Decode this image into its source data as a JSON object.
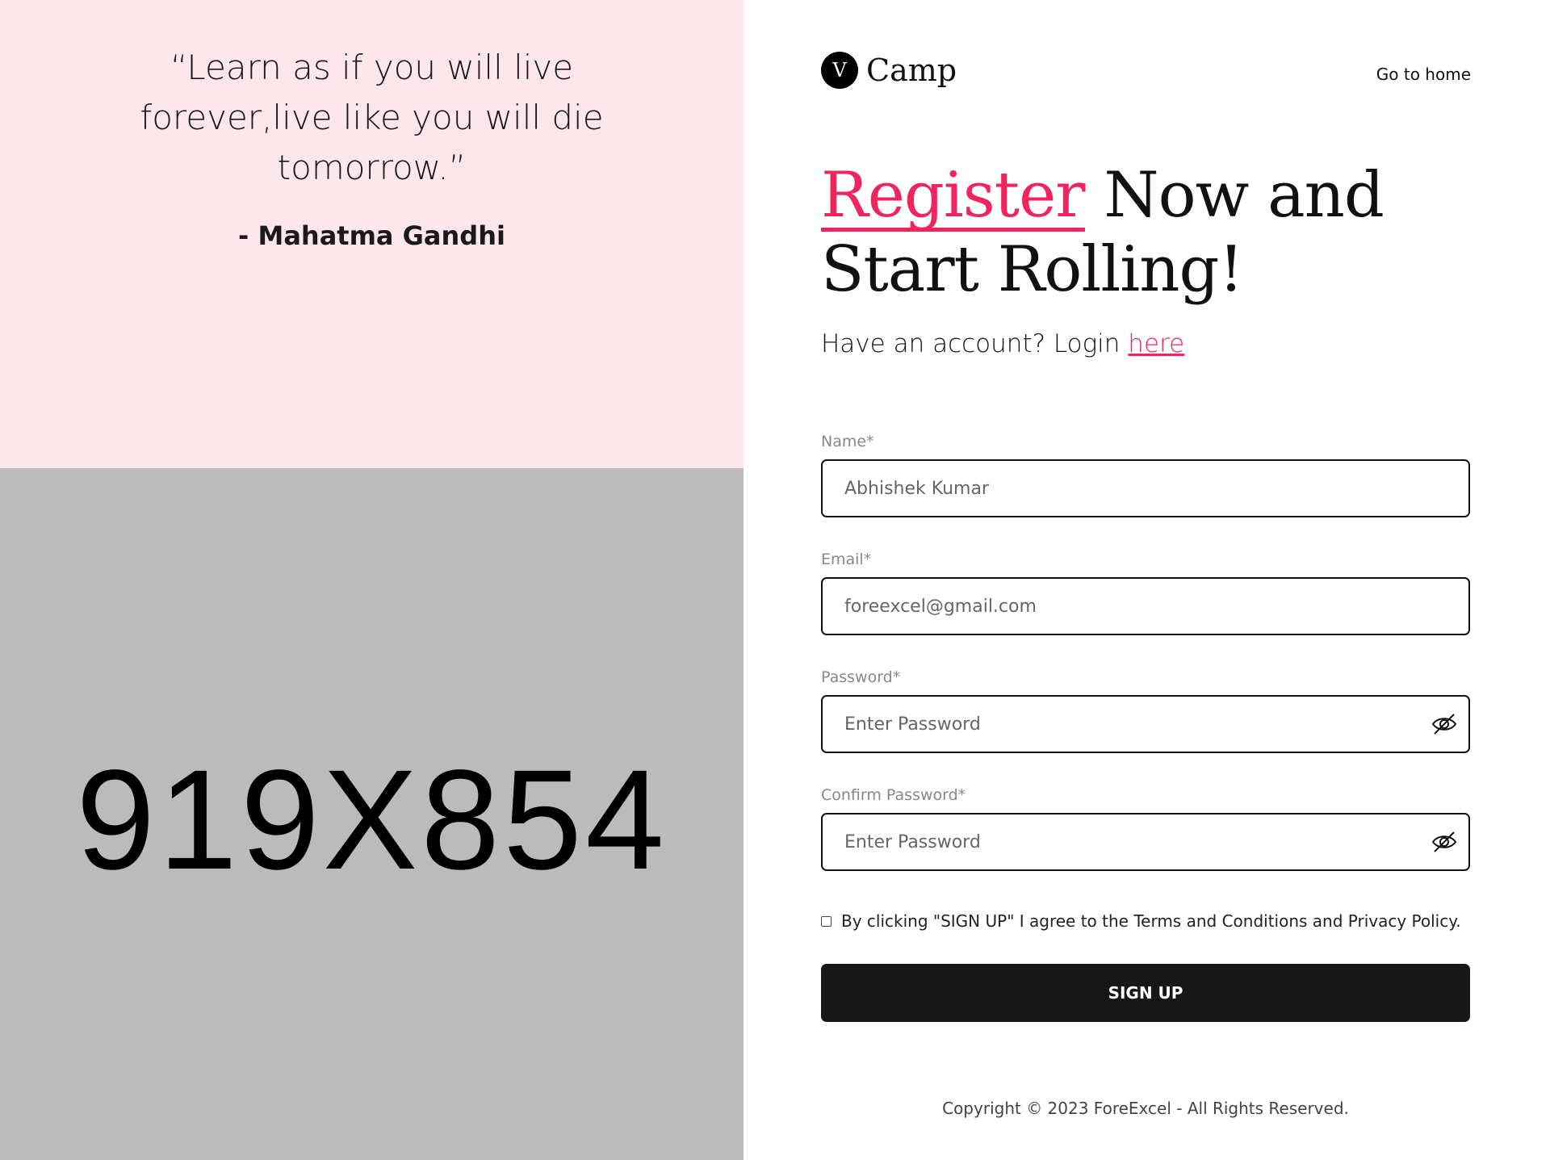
{
  "quote": {
    "text": "“Learn as if you will live forever,live like you will die tomorrow.”",
    "author": "- Mahatma Gandhi"
  },
  "placeholder_image": {
    "label": "919X854"
  },
  "header": {
    "logo_letter": "V",
    "logo_name": "Camp",
    "home_link": "Go to home"
  },
  "headline": {
    "accent": "Register",
    "rest": " Now and Start Rolling!"
  },
  "account": {
    "text": "Have an account? Login ",
    "link": "here"
  },
  "form": {
    "name": {
      "label": "Name*",
      "placeholder": "Abhishek Kumar"
    },
    "email": {
      "label": "Email*",
      "placeholder": "foreexcel@gmail.com"
    },
    "password": {
      "label": "Password*",
      "placeholder": "Enter Password"
    },
    "confirm_password": {
      "label": "Confirm Password*",
      "placeholder": "Enter Password"
    },
    "agree_text": "By clicking \"SIGN UP\" I agree to the Terms and Conditions and Privacy Policy.",
    "submit_label": "SIGN UP"
  },
  "footer": {
    "copyright": "Copyright © 2023 ForeExcel - All Rights Reserved."
  },
  "colors": {
    "accent": "#f0255e",
    "quote_bg": "#fde6ec",
    "placeholder_bg": "#bbbbbb",
    "button_bg": "#171717"
  }
}
